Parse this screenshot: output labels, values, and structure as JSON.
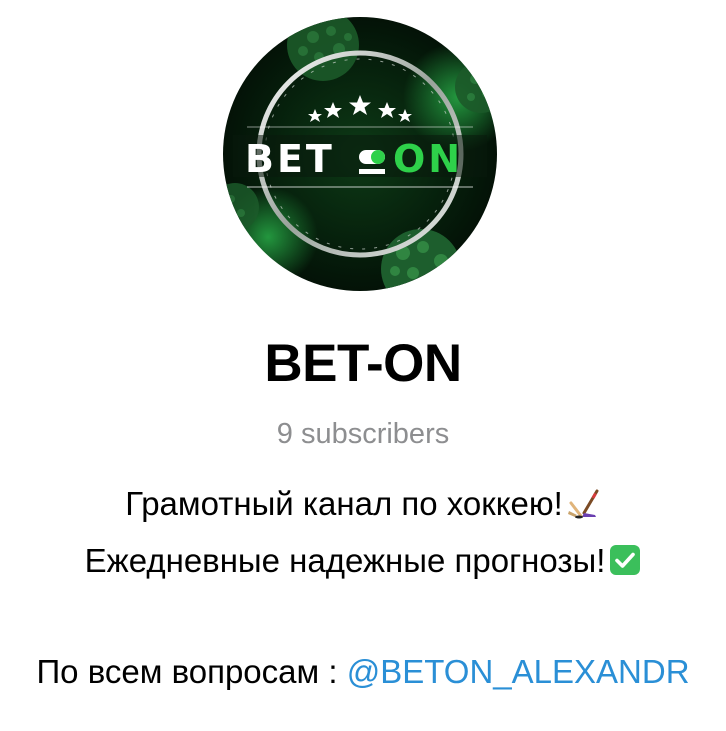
{
  "channel": {
    "name": "BET-ON",
    "subscribers": "9 subscribers",
    "description": {
      "line1": "Грамотный канал по хоккею!",
      "line2": "Ежедневные надежные прогнозы!",
      "contact_prefix": "По всем вопросам : ",
      "contact_link": "@BETON_ALEXANDR"
    },
    "avatar_logo_text": "BET-ON"
  },
  "icons": {
    "hockey": "hockey-stick-icon",
    "check": "check-mark-button-icon"
  },
  "colors": {
    "link": "#2a8fd6",
    "subtitle": "#8d8e90",
    "logo_green": "#2ed14a"
  }
}
